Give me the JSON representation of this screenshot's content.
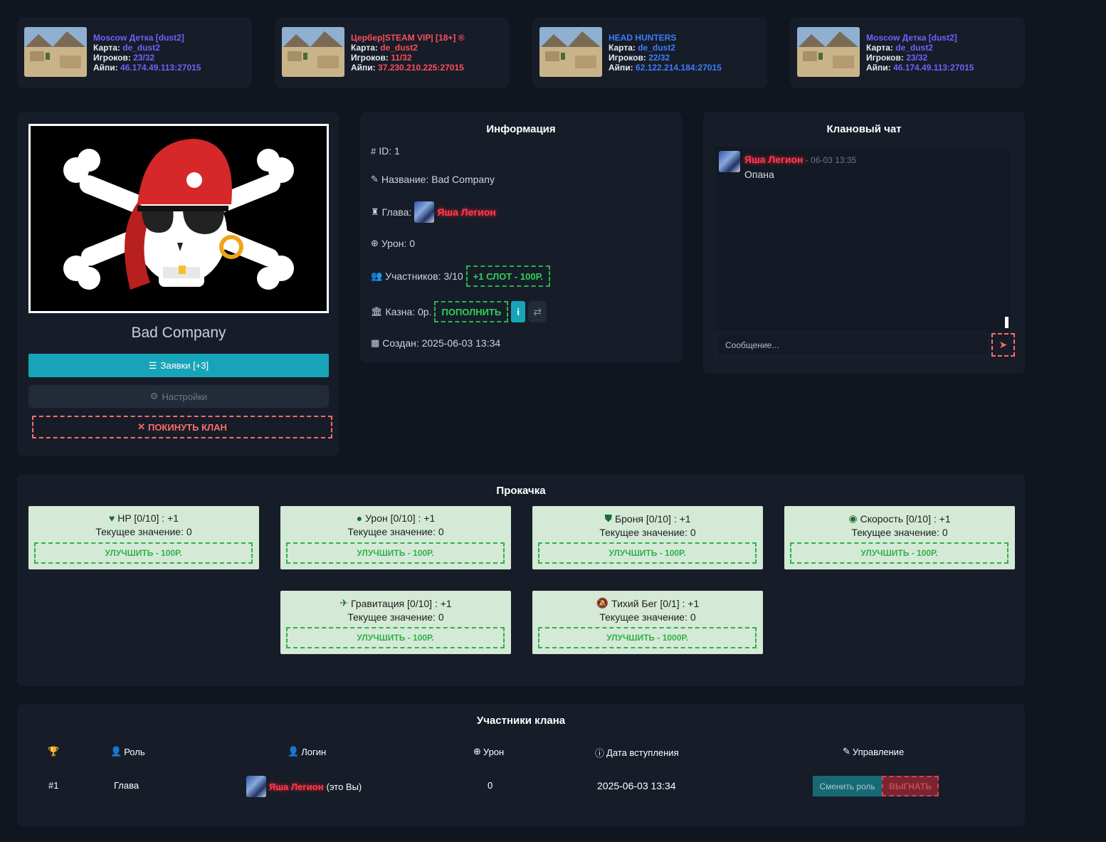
{
  "servers": [
    {
      "name": "Moscow Детка [dust2]",
      "map_label": "Карта:",
      "map": "de_dust2",
      "players_label": "Игроков:",
      "players": "23/32",
      "ip_label": "Айпи:",
      "ip": "46.174.49.113:27015",
      "accent": "#7a5cff"
    },
    {
      "name": "Цербер|STEAM VIP| [18+] ®",
      "map_label": "Карта:",
      "map": "de_dust2",
      "players_label": "Игроков:",
      "players": "11/32",
      "ip_label": "Айпи:",
      "ip": "37.230.210.225:27015",
      "accent": "#ff4d5e"
    },
    {
      "name": "HEAD HUNTERS",
      "map_label": "Карта:",
      "map": "de_dust2",
      "players_label": "Игроков:",
      "players": "22/32",
      "ip_label": "Айпи:",
      "ip": "62.122.214.184:27015",
      "accent": "#3d7dff"
    },
    {
      "name": "Moscow Детка [dust2]",
      "map_label": "Карта:",
      "map": "de_dust2",
      "players_label": "Игроков:",
      "players": "23/32",
      "ip_label": "Айпи:",
      "ip": "46.174.49.113:27015",
      "accent": "#7a5cff"
    }
  ],
  "clan": {
    "name": "Bad Company",
    "requests_label": "Заявки [+3]",
    "settings_label": "Настройки",
    "leave_label": "ПОКИНУТЬ КЛАН"
  },
  "info": {
    "title": "Информация",
    "id_label": "ID: 1",
    "name_label": "Название: Bad Company",
    "leader_label": "Глава:",
    "leader_name": "Яша Легион",
    "damage_label": "Урон: 0",
    "members_label": "Участников: 3/10",
    "slot_button": "+1 СЛОТ - 100Р.",
    "treasury_label": "Казна: 0р.",
    "topup_button": "ПОПОЛНИТЬ",
    "info_button": "i",
    "created_label": "Создан: 2025-06-03 13:34"
  },
  "chat": {
    "title": "Клановый чат",
    "messages": [
      {
        "user": "Яша Легион",
        "time": " - 06-03 13:35",
        "text": "Опана"
      }
    ],
    "input_placeholder": "Сообщение..."
  },
  "upgrades": {
    "title": "Прокачка",
    "current_label": "Текущее значение: 0",
    "items": [
      {
        "title": "HP [0/10] : +1",
        "button": "УЛУЧШИТЬ - 100Р.",
        "icon": "heart-pulse-icon"
      },
      {
        "title": "Урон [0/10] : +1",
        "button": "УЛУЧШИТЬ - 100Р.",
        "icon": "bomb-icon"
      },
      {
        "title": "Броня [0/10] : +1",
        "button": "УЛУЧШИТЬ - 100Р.",
        "icon": "shield-icon"
      },
      {
        "title": "Скорость [0/10] : +1",
        "button": "УЛУЧШИТЬ - 100Р.",
        "icon": "gauge-icon"
      },
      {
        "title": "Гравитация [0/10] : +1",
        "button": "УЛУЧШИТЬ - 100Р.",
        "icon": "plane-icon"
      },
      {
        "title": "Тихий Бег [0/1] : +1",
        "button": "УЛУЧШИТЬ - 1000Р.",
        "icon": "bell-slash-icon"
      }
    ]
  },
  "members": {
    "title": "Участники клана",
    "headers": {
      "role": "Роль",
      "login": "Логин",
      "damage": "Урон",
      "joined": "Дата вступления",
      "manage": "Управление"
    },
    "rows": [
      {
        "rank": "#1",
        "role": "Глава",
        "login": "Яша Легион",
        "suffix": "(это Вы)",
        "damage": "0",
        "joined": "2025-06-03 13:34",
        "change_role": "Сменить роль",
        "kick": "ВЫГНАТЬ"
      }
    ]
  }
}
